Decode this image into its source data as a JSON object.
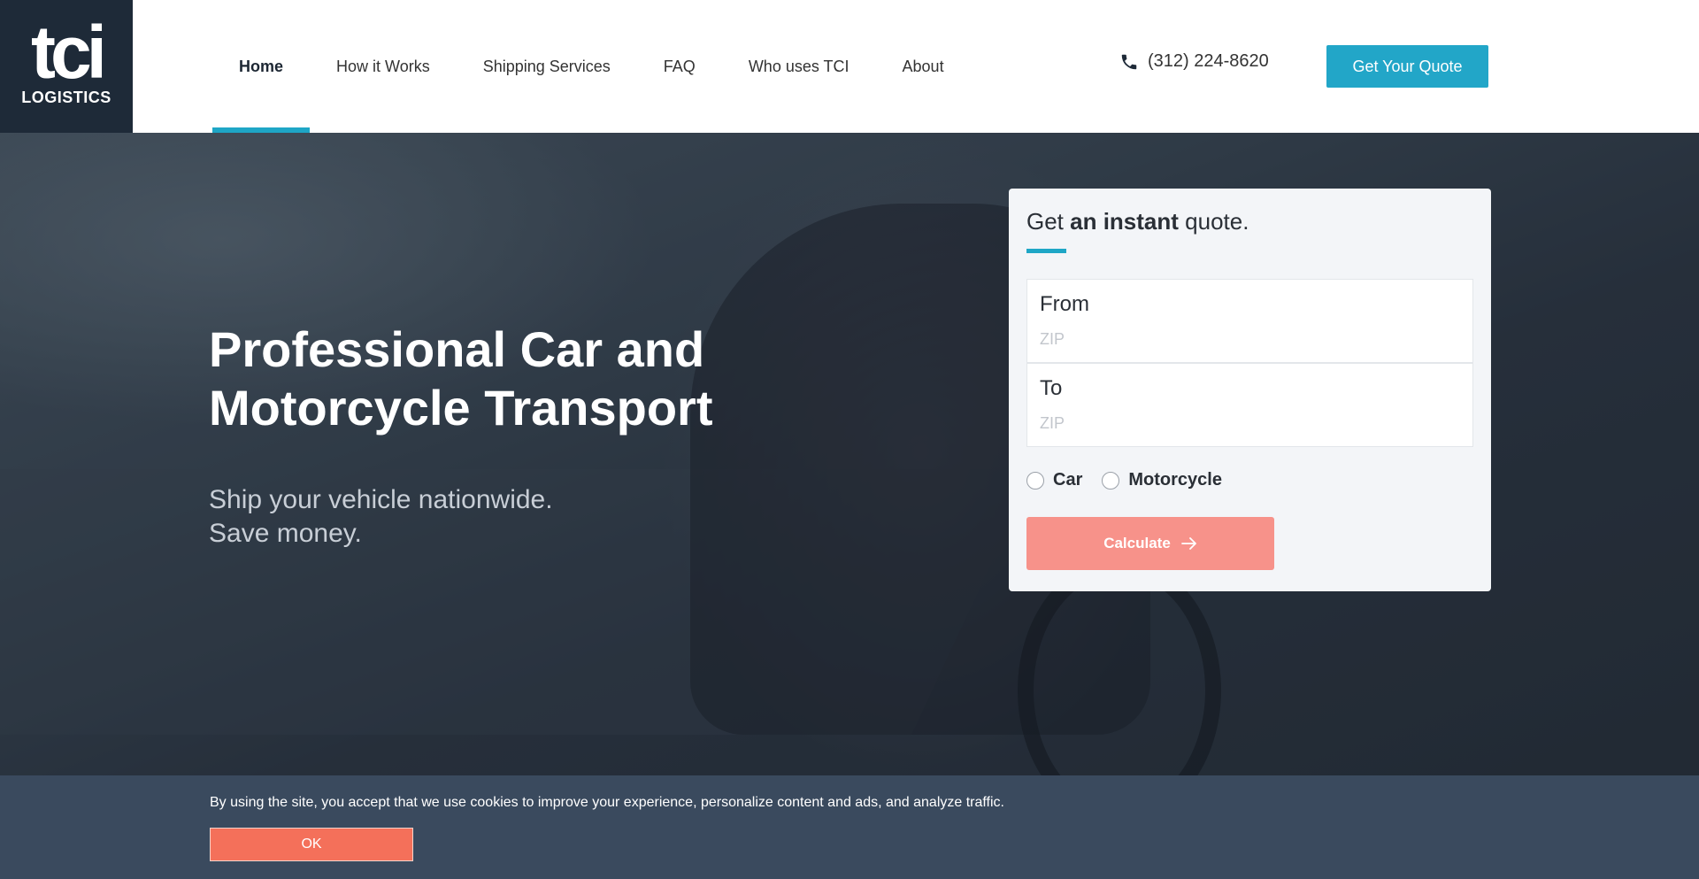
{
  "logo": {
    "mark": "tci",
    "subtitle": "LOGISTICS"
  },
  "nav": {
    "items": [
      {
        "label": "Home",
        "active": true
      },
      {
        "label": "How it Works"
      },
      {
        "label": "Shipping Services"
      },
      {
        "label": "FAQ"
      },
      {
        "label": "Who uses TCI"
      },
      {
        "label": "About"
      }
    ]
  },
  "header": {
    "phone": "(312) 224-8620",
    "quote_button": "Get Your Quote",
    "phone_icon": "phone-icon"
  },
  "hero": {
    "title": "Professional Car and Motorcycle Transport",
    "subtitle_line1": "Ship your vehicle nationwide.",
    "subtitle_line2": "Save money."
  },
  "quote_form": {
    "title_pre": "Get ",
    "title_bold": "an instant",
    "title_post": " quote.",
    "from_label": "From",
    "from_placeholder": "ZIP",
    "from_value": "",
    "to_label": "To",
    "to_placeholder": "ZIP",
    "to_value": "",
    "vehicle_options": [
      "Car",
      "Motorcycle"
    ],
    "calculate_label": "Calculate",
    "calculate_icon": "arrow-right-icon"
  },
  "cookie": {
    "text": "By using the site, you accept that we use cookies to improve your experience, personalize content and ads, and analyze traffic.",
    "ok_label": "OK"
  },
  "colors": {
    "accent": "#1ea6c6",
    "calculate": "#f7928a",
    "cookie_ok": "#f4705a",
    "logo_bg": "#1e2a38",
    "cookie_bg": "#3a4a5e"
  }
}
